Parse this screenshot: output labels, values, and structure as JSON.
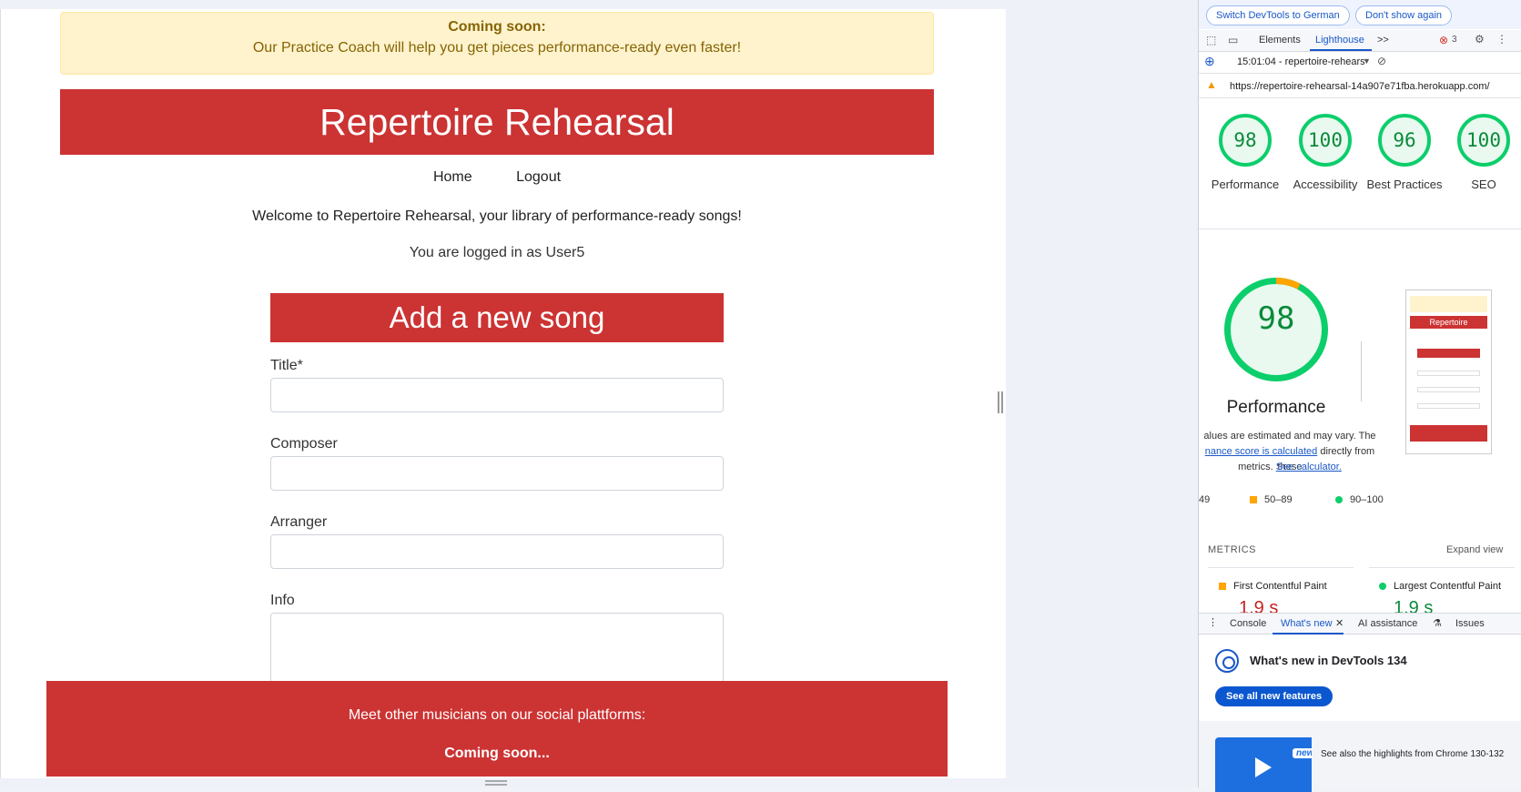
{
  "site": {
    "banner_title": "Coming soon:",
    "banner_text": "Our Practice Coach will help you get pieces performance-ready even faster!",
    "header_title": "Repertoire Rehearsal",
    "nav": {
      "home": "Home",
      "logout": "Logout"
    },
    "welcome": "Welcome to Repertoire Rehearsal, your library of performance-ready songs!",
    "logged_in": "You are logged in as User5",
    "form_title": "Add a new song",
    "fields": {
      "title_label": "Title*",
      "composer_label": "Composer",
      "arranger_label": "Arranger",
      "info_label": "Info"
    },
    "footer": {
      "text": "Meet other musicians on our social plattforms:",
      "coming": "Coming soon..."
    }
  },
  "devtools": {
    "lang_buttons": {
      "switch": "Switch DevTools to German",
      "dismiss": "Don't show again"
    },
    "tabs": {
      "elements": "Elements",
      "lighthouse": "Lighthouse",
      "more": ">>"
    },
    "error_count": "3",
    "report_select": "15:01:04 - repertoire-rehears",
    "url": "https://repertoire-rehearsal-14a907e71fba.herokuapp.com/",
    "scores": [
      {
        "value": "98",
        "label": "Performance"
      },
      {
        "value": "100",
        "label": "Accessibility"
      },
      {
        "value": "96",
        "label": "Best Practices"
      },
      {
        "value": "100",
        "label": "SEO"
      }
    ],
    "main_score": "98",
    "main_label": "Performance",
    "estimate_line1": "alues are estimated and may vary. The",
    "estimate_link": "nance score is calculated",
    "estimate_line2": " directly from these",
    "estimate_line3": "metrics.",
    "calculator_link": "See calculator.",
    "legend": {
      "low": "49",
      "mid": "50–89",
      "high": "90–100"
    },
    "metrics_heading": "METRICS",
    "expand_view": "Expand view",
    "metrics": [
      {
        "name": "First Contentful Paint",
        "value": "1.9 s",
        "color": "#ffa400"
      },
      {
        "name": "Largest Contentful Paint",
        "value": "1.9 s",
        "color": "#0cce6b"
      }
    ],
    "bottom_tabs": {
      "console": "Console",
      "whats_new": "What's new",
      "ai": "AI assistance",
      "issues": "Issues"
    },
    "whats_new_title": "What's new in DevTools 134",
    "see_all": "See all new features",
    "new_badge": "new",
    "highlights": "See also the highlights from Chrome 130-132"
  },
  "colors": {
    "brand_red": "#cc3333",
    "banner_bg": "#fff3cd",
    "lh_green": "#0cce6b",
    "lh_orange": "#ffa400",
    "devtools_blue": "#1a58c8"
  }
}
